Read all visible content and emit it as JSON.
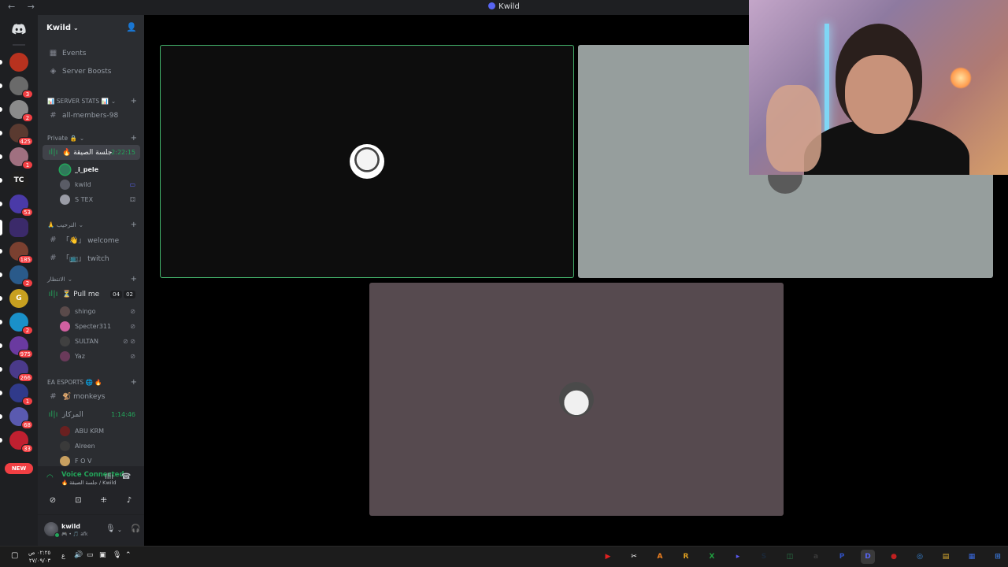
{
  "window": {
    "title": "Kwild",
    "nav": "← →"
  },
  "server_rail": {
    "home_icon": "discord-icon",
    "servers": [
      {
        "color": "#b8321f",
        "badge": ""
      },
      {
        "color": "#6a6a6a",
        "badge": "3"
      },
      {
        "color": "#8b8b8b",
        "badge": "2"
      },
      {
        "color": "#5a3a30",
        "badge": "425"
      },
      {
        "color": "#a07080",
        "badge": "1"
      },
      {
        "color": "#202020",
        "badge": "",
        "label": "TC"
      },
      {
        "color": "#4a3aa8",
        "badge": "53"
      },
      {
        "color": "#3b2a6a",
        "badge": "",
        "selected": true
      },
      {
        "color": "#7a4030",
        "badge": "185"
      },
      {
        "color": "#2a5a8a",
        "badge": "2"
      },
      {
        "color": "#c8a020",
        "badge": "",
        "label": "G"
      },
      {
        "color": "#1a90c8",
        "badge": "2"
      },
      {
        "color": "#6a3aa0",
        "badge": "975"
      },
      {
        "color": "#4a3a8a",
        "badge": "266"
      },
      {
        "color": "#303a8a",
        "badge": "1"
      },
      {
        "color": "#5a5ab0",
        "badge": "68"
      },
      {
        "color": "#c02030",
        "badge": "33"
      }
    ],
    "new_label": "NEW"
  },
  "guild": {
    "name": "Kwild"
  },
  "channels": {
    "events": "Events",
    "server_boosts": "Server Boosts",
    "cat_server_stats": "📊 SERVER STATS 📊",
    "all_members": "all-members-98",
    "cat_private": "Private 🔒",
    "voice_private": "🔥 جلسة الصيقة",
    "voice_private_timer": "2:22:15",
    "private_users": [
      {
        "name": "_i_pele",
        "color": "#2f7a5a"
      },
      {
        "name": "kwild",
        "color": "#5a5c66"
      },
      {
        "name": "S TEX",
        "color": "#9a9ca6"
      }
    ],
    "cat_welcome": "🙏 الترحيب",
    "welcome": "「👋」 welcome",
    "twitch": "「📺」 twitch",
    "cat_waiting": "الانتظار",
    "pull_me": "⏳ Pull me",
    "pull_me_counts": [
      "04",
      "02"
    ],
    "pull_users": [
      {
        "name": "shingo",
        "color": "#5a4a4a"
      },
      {
        "name": "Specter311",
        "color": "#d060a0"
      },
      {
        "name": "SULTAN",
        "color": "#404040"
      },
      {
        "name": "Yaz",
        "color": "#6a3a5a"
      }
    ],
    "cat_ea": "EA ESPORTS 🌐 🔥",
    "monkeys": "🐒 monkeys",
    "voice_center": "المركاز",
    "voice_center_timer": "1:14:46",
    "center_users": [
      {
        "name": "ABU KRM",
        "color": "#6a2020"
      },
      {
        "name": "Alreen",
        "color": "#3a3a3a"
      },
      {
        "name": "F O V",
        "color": "#c8a060"
      }
    ]
  },
  "voice_panel": {
    "status": "Voice Connected",
    "channel": "🔥 جلسة الصيقة / Kwild"
  },
  "user_panel": {
    "username": "kwild",
    "status_text": "🎮 • 🎵 afk"
  },
  "stage": {
    "tile_colors": [
      "#0d0d0d",
      "#969e9d",
      "#564a4f"
    ]
  },
  "taskbar": {
    "time": "٠٢:٢٥ ص",
    "date": "٢٧/٠٩/٠٣",
    "lang": "ع",
    "apps": [
      {
        "label": "▶",
        "color": "#e02020"
      },
      {
        "label": "✂",
        "color": "#ffffff"
      },
      {
        "label": "A",
        "color": "#f08020"
      },
      {
        "label": "R",
        "color": "#e0a020"
      },
      {
        "label": "X",
        "color": "#20a040"
      },
      {
        "label": "▸",
        "color": "#5a5af0"
      },
      {
        "label": "S",
        "color": "#1b2838"
      },
      {
        "label": "◫",
        "color": "#2a7a4a"
      },
      {
        "label": "a",
        "color": "#3a3a3a"
      },
      {
        "label": "P",
        "color": "#3050c0"
      },
      {
        "label": "D",
        "color": "#5865f2",
        "active": true
      },
      {
        "label": "●",
        "color": "#c02020"
      },
      {
        "label": "◎",
        "color": "#3a8ae0"
      },
      {
        "label": "▤",
        "color": "#e0b030"
      },
      {
        "label": "▦",
        "color": "#3a6ae0"
      },
      {
        "label": "⊞",
        "color": "#3a7ae0"
      }
    ]
  }
}
